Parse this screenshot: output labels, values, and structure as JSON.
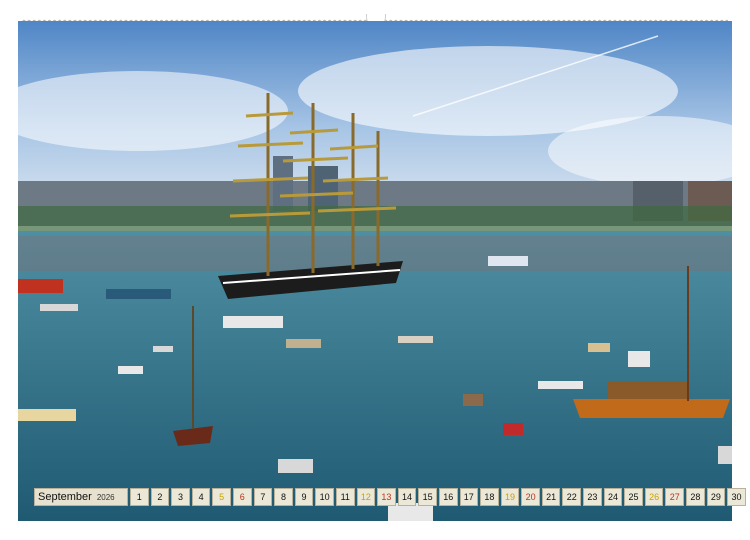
{
  "calendar": {
    "month": "September",
    "year": "2026",
    "days": [
      {
        "n": "1",
        "kind": "weekday"
      },
      {
        "n": "2",
        "kind": "weekday"
      },
      {
        "n": "3",
        "kind": "weekday"
      },
      {
        "n": "4",
        "kind": "weekday"
      },
      {
        "n": "5",
        "kind": "sat"
      },
      {
        "n": "6",
        "kind": "sun"
      },
      {
        "n": "7",
        "kind": "weekday"
      },
      {
        "n": "8",
        "kind": "weekday"
      },
      {
        "n": "9",
        "kind": "weekday"
      },
      {
        "n": "10",
        "kind": "weekday"
      },
      {
        "n": "11",
        "kind": "weekday"
      },
      {
        "n": "12",
        "kind": "sat"
      },
      {
        "n": "13",
        "kind": "sun"
      },
      {
        "n": "14",
        "kind": "weekday"
      },
      {
        "n": "15",
        "kind": "weekday"
      },
      {
        "n": "16",
        "kind": "weekday"
      },
      {
        "n": "17",
        "kind": "weekday"
      },
      {
        "n": "18",
        "kind": "weekday"
      },
      {
        "n": "19",
        "kind": "sat"
      },
      {
        "n": "20",
        "kind": "sun"
      },
      {
        "n": "21",
        "kind": "weekday"
      },
      {
        "n": "22",
        "kind": "weekday"
      },
      {
        "n": "23",
        "kind": "weekday"
      },
      {
        "n": "24",
        "kind": "weekday"
      },
      {
        "n": "25",
        "kind": "weekday"
      },
      {
        "n": "26",
        "kind": "sat"
      },
      {
        "n": "27",
        "kind": "sun"
      },
      {
        "n": "28",
        "kind": "weekday"
      },
      {
        "n": "29",
        "kind": "weekday"
      },
      {
        "n": "30",
        "kind": "weekday"
      }
    ]
  },
  "colors": {
    "saturday": "#c8a300",
    "sunday": "#c0311f",
    "cell_background": "#ece8d8",
    "water": "#2f6f86",
    "sky": "#6f9fd0"
  }
}
